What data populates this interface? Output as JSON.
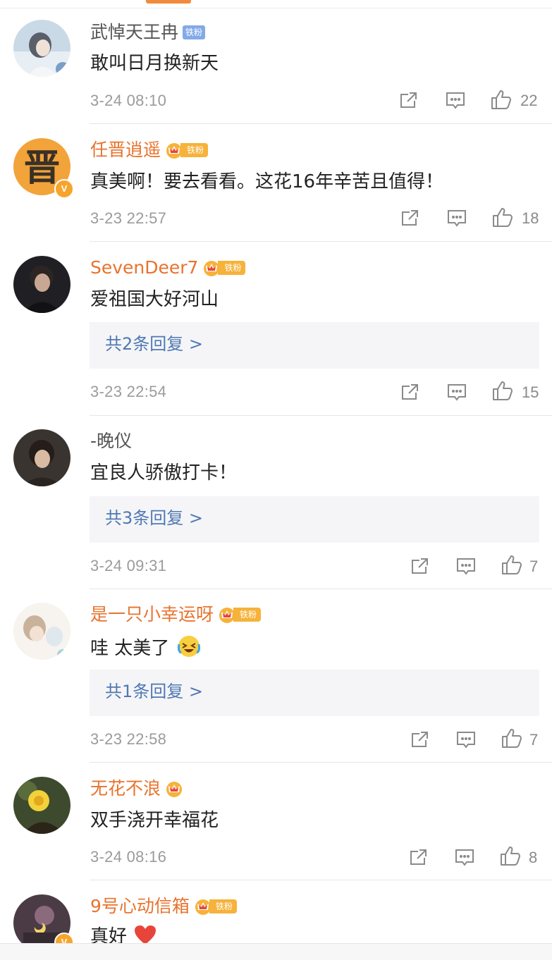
{
  "comments": [
    {
      "username": "武悼天王冉",
      "badge": "铁粉",
      "text": "敢叫日月换新天",
      "time": "3-24 08:10",
      "likes": "22"
    },
    {
      "username": "任晋逍遥",
      "badge": "铁粉",
      "avatar_text": "晋",
      "verified": "V",
      "text": "真美啊！要去看看。这花16年辛苦且值得！",
      "time": "3-23 22:57",
      "likes": "18"
    },
    {
      "username": "SevenDeer7",
      "badge": "铁粉",
      "text": "爱祖国大好河山",
      "replies": "共2条回复 >",
      "time": "3-23 22:54",
      "likes": "15"
    },
    {
      "username": "-晚仪",
      "text": "宜良人骄傲打卡！",
      "replies": "共3条回复 >",
      "time": "3-24 09:31",
      "likes": "7"
    },
    {
      "username": "是一只小幸运呀",
      "badge": "铁粉",
      "text": "哇 太美了",
      "replies": "共1条回复 >",
      "time": "3-23 22:58",
      "likes": "7"
    },
    {
      "username": "无花不浪",
      "text": "双手浇开幸福花",
      "time": "3-24 08:16",
      "likes": "8"
    },
    {
      "username": "9号心动信箱",
      "badge": "铁粉",
      "verified": "V",
      "text": "真好"
    }
  ],
  "colors": {
    "accent": "#f28a3c",
    "username_vip": "#e8732e",
    "reply_link": "#4f78b3",
    "fan_badge": "#f6b23a"
  },
  "icons": [
    "share-icon",
    "comment-icon",
    "thumbs-up-icon",
    "crown-icon",
    "laughing-emoji-icon",
    "heart-emoji-icon"
  ]
}
